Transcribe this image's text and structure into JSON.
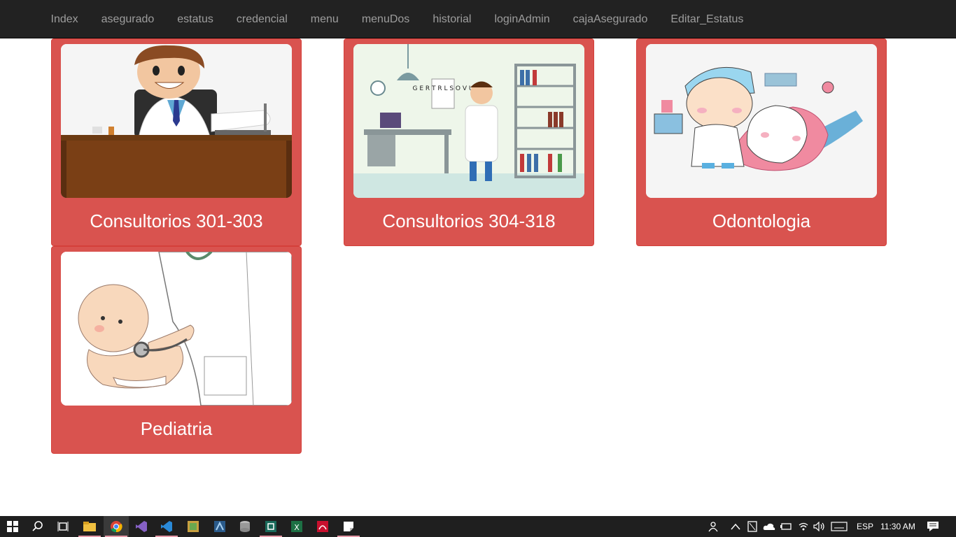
{
  "nav": {
    "items": [
      "Index",
      "asegurado",
      "estatus",
      "credencial",
      "menu",
      "menuDos",
      "historial",
      "loginAdmin",
      "cajaAsegurado",
      "Editar_Estatus"
    ]
  },
  "cards": [
    {
      "label": "Consultorios 301-303",
      "image": "doctor-at-desk-illustration"
    },
    {
      "label": "Consultorios 304-318",
      "image": "doctor-in-office-illustration"
    },
    {
      "label": "Odontologia",
      "image": "dentist-with-tooth-illustration"
    },
    {
      "label": "Pediatria",
      "image": "doctor-examining-baby-illustration"
    }
  ],
  "colors": {
    "card": "#d9534f",
    "navbar": "#222222",
    "nav_text": "#9d9d9d"
  },
  "taskbar": {
    "apps": [
      "windows-start-icon",
      "search-icon",
      "task-view-icon",
      "file-explorer-icon",
      "chrome-icon",
      "visual-studio-icon",
      "vscode-icon",
      "app-icon",
      "app-icon-2",
      "database-icon",
      "app-icon-3",
      "excel-icon",
      "acrobat-icon",
      "sticky-notes-icon"
    ],
    "language": "ESP",
    "time": "11:30 AM"
  },
  "illustrations": {
    "eye_chart_letters": "G\nE R T\nR L S O V U"
  }
}
